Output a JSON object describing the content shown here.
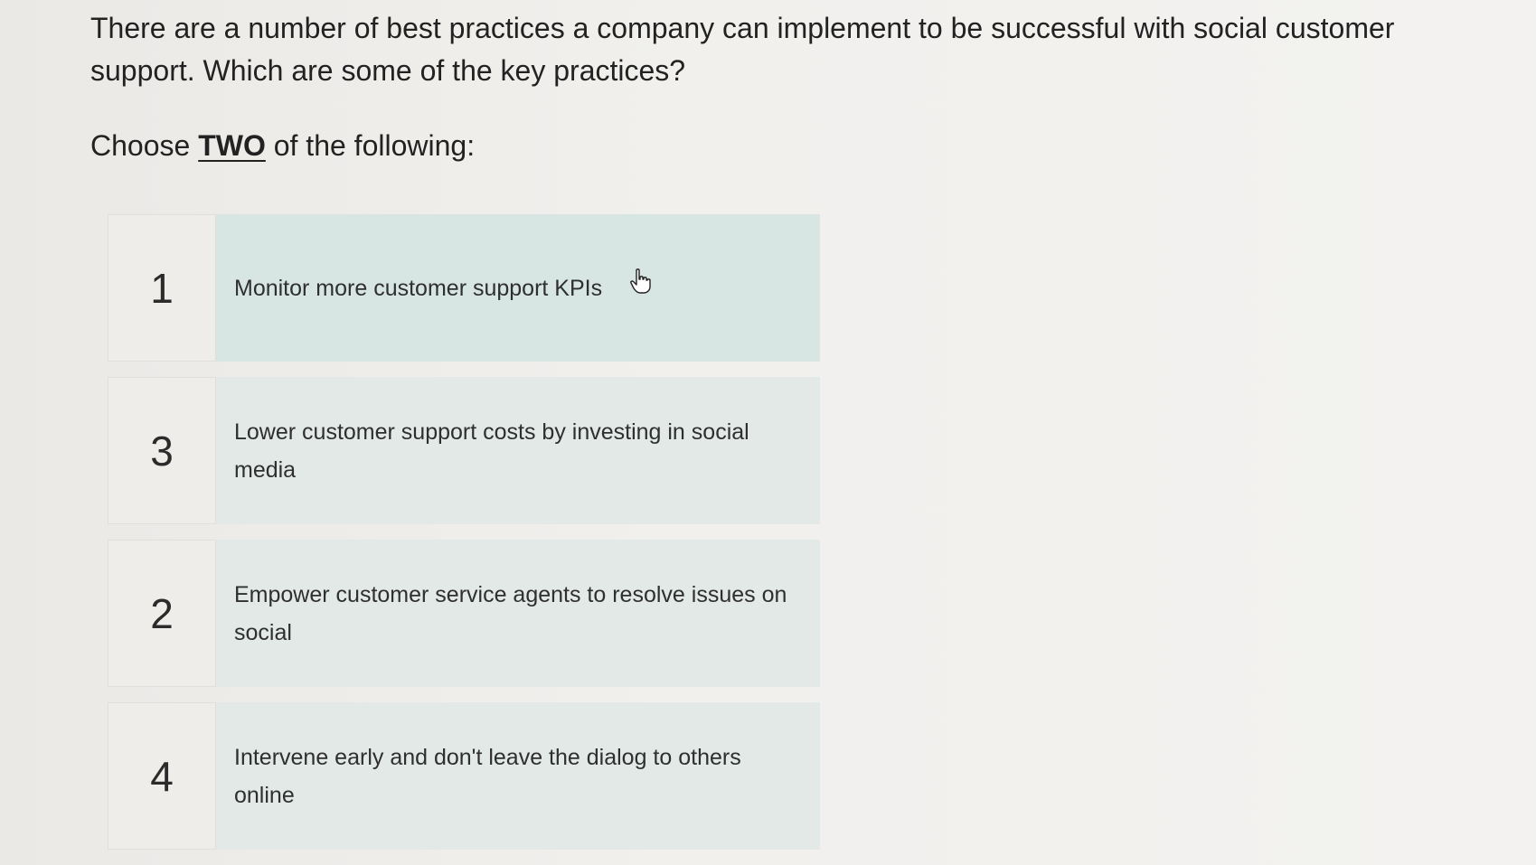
{
  "question": {
    "text": "There are a number of best practices a company can implement to be successful with social customer support. Which are some of the key practices?"
  },
  "instruction": {
    "prefix": "Choose ",
    "emphasis": "TWO",
    "suffix": " of the following:"
  },
  "options": [
    {
      "number": "1",
      "text": "Monitor more customer support KPIs"
    },
    {
      "number": "3",
      "text": "Lower customer support costs by investing in social media"
    },
    {
      "number": "2",
      "text": "Empower customer service agents to resolve issues on social"
    },
    {
      "number": "4",
      "text": "Intervene early and don't leave the dialog to others online"
    }
  ],
  "cursor": {
    "icon": "hand-pointer-icon"
  }
}
